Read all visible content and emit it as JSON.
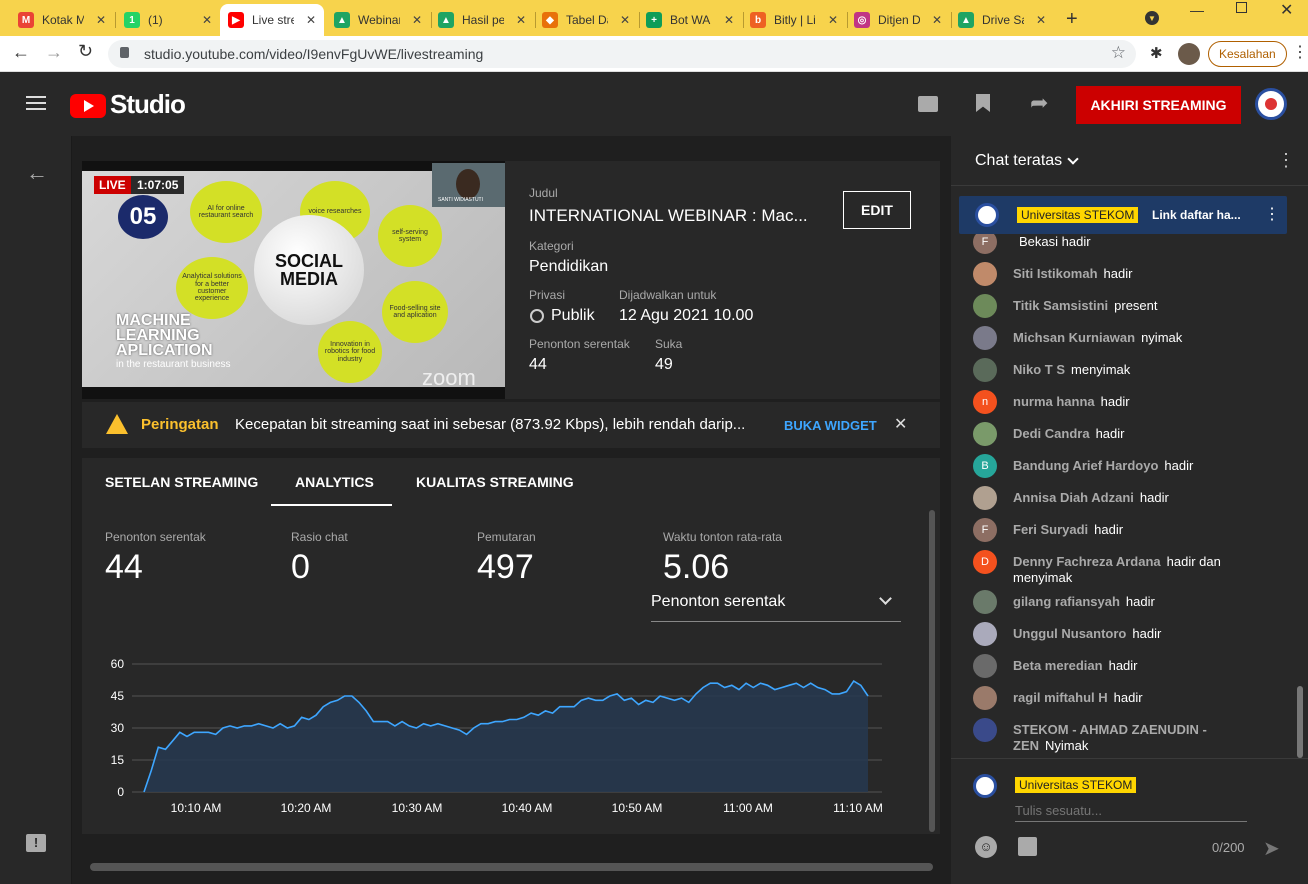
{
  "browser": {
    "tabs": [
      {
        "title": "Kotak Masuk",
        "fav": "M",
        "color": "#ea4335"
      },
      {
        "title": "(1)",
        "fav": "1",
        "color": "#25d366"
      },
      {
        "title": "Live streaming",
        "fav": "▶",
        "color": "#ff0000"
      },
      {
        "title": "Webinar",
        "fav": "▲",
        "color": "#1fa463"
      },
      {
        "title": "Hasil pencarian",
        "fav": "▲",
        "color": "#1fa463"
      },
      {
        "title": "Tabel Data",
        "fav": "◆",
        "color": "#e8710a"
      },
      {
        "title": "Bot WA",
        "fav": "+",
        "color": "#0f9d58"
      },
      {
        "title": "Bitly | Links",
        "fav": "b",
        "color": "#ee6123"
      },
      {
        "title": "Ditjen Dikti",
        "fav": "◎",
        "color": "#c13584"
      },
      {
        "title": "Drive Saya",
        "fav": "▲",
        "color": "#1fa463"
      }
    ],
    "url": "studio.youtube.com/video/I9envFgUvWE/livestreaming",
    "error_chip": "Kesalahan"
  },
  "header": {
    "logo": "Studio",
    "end_button": "AKHIRI STREAMING"
  },
  "preview": {
    "live": "LIVE",
    "elapsed": "1:07:05",
    "slide_number": "05",
    "bubbles": [
      "AI for online restaurant search",
      "voice researches",
      "self-serving system",
      "Analytical solutions for a better customer experience",
      "Food-selling site and aplication",
      "Innovation in robotics for food industry"
    ],
    "center": "SOCIAL MEDIA",
    "headline": "MACHINE LEARNING APLICATION",
    "subline": "in the restaurant business",
    "zoom": "zoom",
    "cam_name": "SANTI WIDIASTUTI"
  },
  "meta": {
    "title_label": "Judul",
    "title": "INTERNATIONAL WEBINAR : Mac...",
    "edit": "EDIT",
    "category_label": "Kategori",
    "category": "Pendidikan",
    "privacy_label": "Privasi",
    "privacy": "Publik",
    "scheduled_label": "Dijadwalkan untuk",
    "scheduled": "12 Agu 2021 10.00",
    "concurrent_label": "Penonton serentak",
    "concurrent": "44",
    "likes_label": "Suka",
    "likes": "49"
  },
  "warning": {
    "label": "Peringatan",
    "message": "Kecepatan bit streaming saat ini sebesar (873.92 Kbps), lebih rendah darip...",
    "action": "BUKA WIDGET"
  },
  "stream_tabs": [
    "SETELAN STREAMING",
    "ANALYTICS",
    "KUALITAS STREAMING"
  ],
  "stats": [
    {
      "label": "Penonton serentak",
      "value": "44"
    },
    {
      "label": "Rasio chat",
      "value": "0"
    },
    {
      "label": "Pemutaran",
      "value": "497"
    },
    {
      "label": "Waktu tonton rata-rata",
      "value": "5.06"
    }
  ],
  "metric_select": "Penonton serentak",
  "chart_data": {
    "type": "area",
    "x_tick_labels": [
      "10:10 AM",
      "10:20 AM",
      "10:30 AM",
      "10:40 AM",
      "10:50 AM",
      "11:00 AM",
      "11:10 AM"
    ],
    "y_ticks": [
      0,
      15,
      30,
      45,
      60
    ],
    "ylim": [
      0,
      60
    ],
    "series": [
      {
        "values": [
          0,
          10,
          21,
          20,
          24,
          28,
          26,
          28,
          28,
          28,
          27,
          30,
          31,
          30,
          31,
          31,
          32,
          31,
          30,
          32,
          30,
          31,
          35,
          34,
          36,
          40,
          42,
          43,
          45,
          45,
          42,
          38,
          33,
          33,
          33,
          31,
          33,
          31,
          30,
          32,
          31,
          32,
          31,
          30,
          29,
          27,
          30,
          32,
          32,
          33,
          33,
          34,
          34,
          35,
          37,
          36,
          38,
          37,
          40,
          40,
          40,
          43,
          44,
          43,
          43,
          45,
          46,
          43,
          44,
          41,
          43,
          42,
          45,
          44,
          43,
          44,
          42,
          46,
          49,
          51,
          51,
          49,
          50,
          48,
          51,
          49,
          51,
          50,
          48,
          49,
          50,
          51,
          49,
          51,
          49,
          48,
          46,
          46,
          47,
          52,
          50,
          45
        ]
      }
    ],
    "accent": "#3ea6ff"
  },
  "chat": {
    "title": "Chat teratas",
    "pinned": {
      "author": "Universitas STEKOM",
      "text": "Link daftar ha..."
    },
    "messages": [
      {
        "author": "",
        "text": "Bekasi hadir",
        "avatar_color": "#8d6e63",
        "initial": "F"
      },
      {
        "author": "Siti Istikomah",
        "text": "hadir",
        "avatar_color": "#c08a6a",
        "initial": ""
      },
      {
        "author": "Titik Samsistini",
        "text": "present",
        "avatar_color": "#6d8a5a",
        "initial": ""
      },
      {
        "author": "Michsan Kurniawan",
        "text": "nyimak",
        "avatar_color": "#7a7a8a",
        "initial": ""
      },
      {
        "author": "Niko T S",
        "text": "menyimak",
        "avatar_color": "#5a6a5a",
        "initial": ""
      },
      {
        "author": "nurma hanna",
        "text": "hadir",
        "avatar_color": "#f4511e",
        "initial": "n"
      },
      {
        "author": "Dedi Candra",
        "text": "hadir",
        "avatar_color": "#7a9a6a",
        "initial": ""
      },
      {
        "author": "Bandung Arief Hardoyo",
        "text": "hadir",
        "avatar_color": "#26a69a",
        "initial": "B"
      },
      {
        "author": "Annisa Diah Adzani",
        "text": "hadir",
        "avatar_color": "#b0a090",
        "initial": ""
      },
      {
        "author": "Feri Suryadi",
        "text": "hadir",
        "avatar_color": "#8d6e63",
        "initial": "F"
      },
      {
        "author": "Denny Fachreza Ardana",
        "text": "hadir dan menyimak",
        "avatar_color": "#f4511e",
        "initial": "D"
      },
      {
        "author": "gilang rafiansyah",
        "text": "hadir",
        "avatar_color": "#6a7a6a",
        "initial": ""
      },
      {
        "author": "Unggul Nusantoro",
        "text": "hadir",
        "avatar_color": "#aab",
        "initial": ""
      },
      {
        "author": "Beta meredian",
        "text": "hadir",
        "avatar_color": "#6a6a6a",
        "initial": ""
      },
      {
        "author": "ragil miftahul H",
        "text": "hadir",
        "avatar_color": "#9a7a6a",
        "initial": ""
      },
      {
        "author": "STEKOM - AHMAD ZAENUDIN - ZEN",
        "text": "Nyimak",
        "avatar_color": "#3a4a8a",
        "initial": ""
      }
    ],
    "composer_author": "Universitas STEKOM",
    "placeholder": "Tulis sesuatu...",
    "counter": "0/200"
  }
}
